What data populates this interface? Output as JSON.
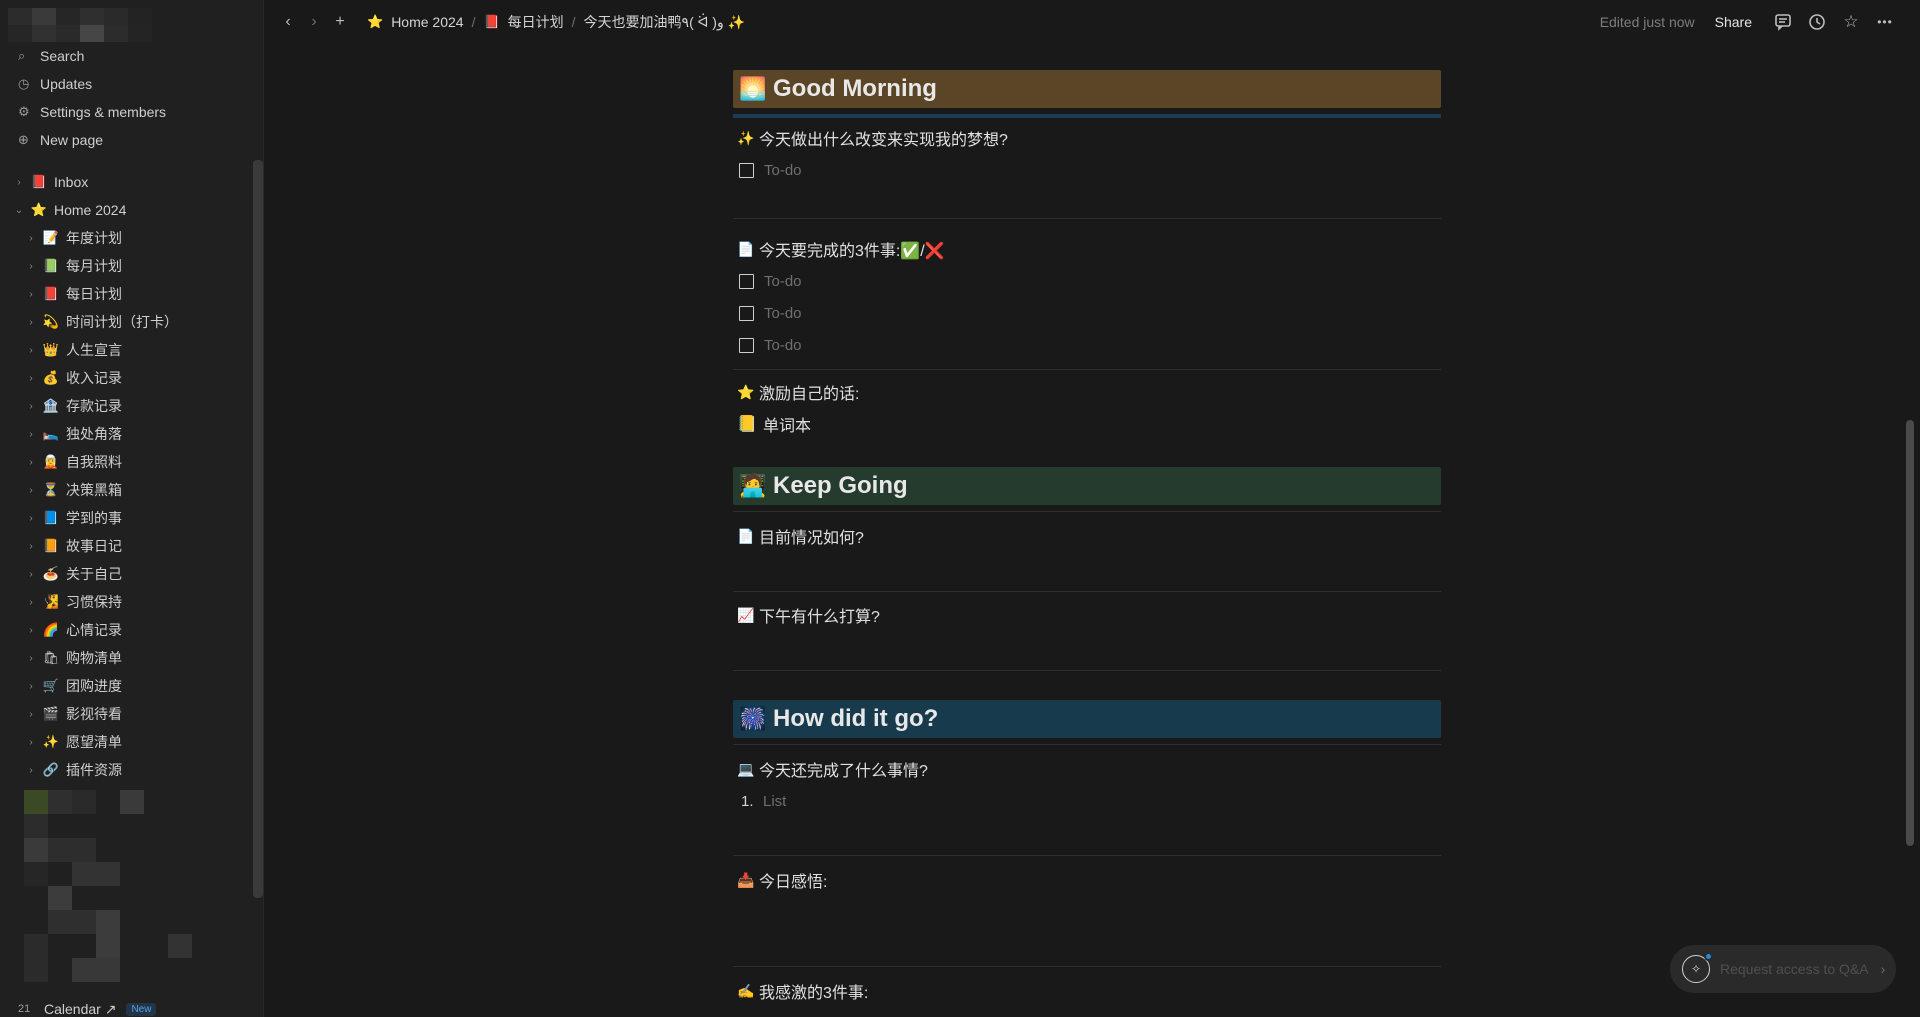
{
  "sidebar": {
    "actions": [
      {
        "label": "Search",
        "icon": "search-icon",
        "glyph": "⌕"
      },
      {
        "label": "Updates",
        "icon": "clock-icon",
        "glyph": "◷"
      },
      {
        "label": "Settings & members",
        "icon": "gear-icon",
        "glyph": "⚙"
      },
      {
        "label": "New page",
        "icon": "plus-circle-icon",
        "glyph": "⊕"
      }
    ],
    "top_items": [
      {
        "label": "Inbox",
        "emoji": "📕",
        "chevron": "›"
      },
      {
        "label": "Home 2024",
        "emoji": "⭐",
        "chevron": "⌄"
      }
    ],
    "sub_items": [
      {
        "label": "年度计划",
        "emoji": "📝"
      },
      {
        "label": "每月计划",
        "emoji": "📗"
      },
      {
        "label": "每日计划",
        "emoji": "📕"
      },
      {
        "label": "时间计划（打卡）",
        "emoji": "💫"
      },
      {
        "label": "人生宣言",
        "emoji": "👑"
      },
      {
        "label": "收入记录",
        "emoji": "💰"
      },
      {
        "label": "存款记录",
        "emoji": "🏦"
      },
      {
        "label": "独处角落",
        "emoji": "🛌"
      },
      {
        "label": "自我照料",
        "emoji": "🧝"
      },
      {
        "label": "决策黑箱",
        "emoji": "⏳"
      },
      {
        "label": "学到的事",
        "emoji": "📘"
      },
      {
        "label": "故事日记",
        "emoji": "📙"
      },
      {
        "label": "关于自己",
        "emoji": "🍝"
      },
      {
        "label": "习惯保持",
        "emoji": "🧏"
      },
      {
        "label": "心情记录",
        "emoji": "🌈"
      },
      {
        "label": "购物清单",
        "emoji": "🛍"
      },
      {
        "label": "团购进度",
        "emoji": "🛒"
      },
      {
        "label": "影视待看",
        "emoji": "🎬"
      },
      {
        "label": "愿望清单",
        "emoji": "✨"
      },
      {
        "label": "插件资源",
        "emoji": "🔗"
      }
    ],
    "sub_chevron": "›",
    "calendar": {
      "label": "Calendar ↗",
      "icon": "calendar-icon",
      "glyph": "21",
      "badge": "New"
    }
  },
  "topbar": {
    "back": "‹",
    "forward": "›",
    "add": "+",
    "breadcrumbs": [
      {
        "label": "Home 2024",
        "emoji": "⭐"
      },
      {
        "label": "每日计划",
        "emoji": "📕"
      },
      {
        "label": "今天也要加油鸭٩( ᐛ )و ✨",
        "emoji": ""
      }
    ],
    "separator": "/",
    "edited": "Edited just now",
    "share": "Share",
    "icons": {
      "comment": "💬",
      "history": "◷",
      "favorite": "☆",
      "more": "•••"
    }
  },
  "page": {
    "sections": {
      "morning": {
        "emoji": "🌅",
        "title": "Good Morning"
      },
      "going": {
        "emoji": "🧑‍💻",
        "title": "Keep Going"
      },
      "how": {
        "emoji": "🎆",
        "title": "How did it go?"
      }
    },
    "q1": {
      "emoji": "✨",
      "text": "今天做出什么改变来实现我的梦想?"
    },
    "todo_placeholder": "To-do",
    "q2": {
      "emoji": "📄",
      "text": "今天要完成的3件事:✅/❌"
    },
    "q3": {
      "emoji": "⭐",
      "text": "激励自己的话:"
    },
    "wordbook": {
      "emoji": "📒",
      "text": "单词本"
    },
    "q4": {
      "emoji": "📄",
      "text": "目前情况如何?"
    },
    "q5": {
      "emoji": "📈",
      "text": "下午有什么打算?"
    },
    "q6": {
      "emoji": "💻",
      "text": "今天还完成了什么事情?"
    },
    "list": {
      "num": "1.",
      "placeholder": "List"
    },
    "q7": {
      "emoji": "📥",
      "text": "今日感悟:"
    },
    "q8": {
      "emoji": "✍️",
      "text": "我感激的3件事:"
    }
  },
  "qa": {
    "label": "Request access to Q&A",
    "glyph": "✧",
    "arrow": "›"
  }
}
